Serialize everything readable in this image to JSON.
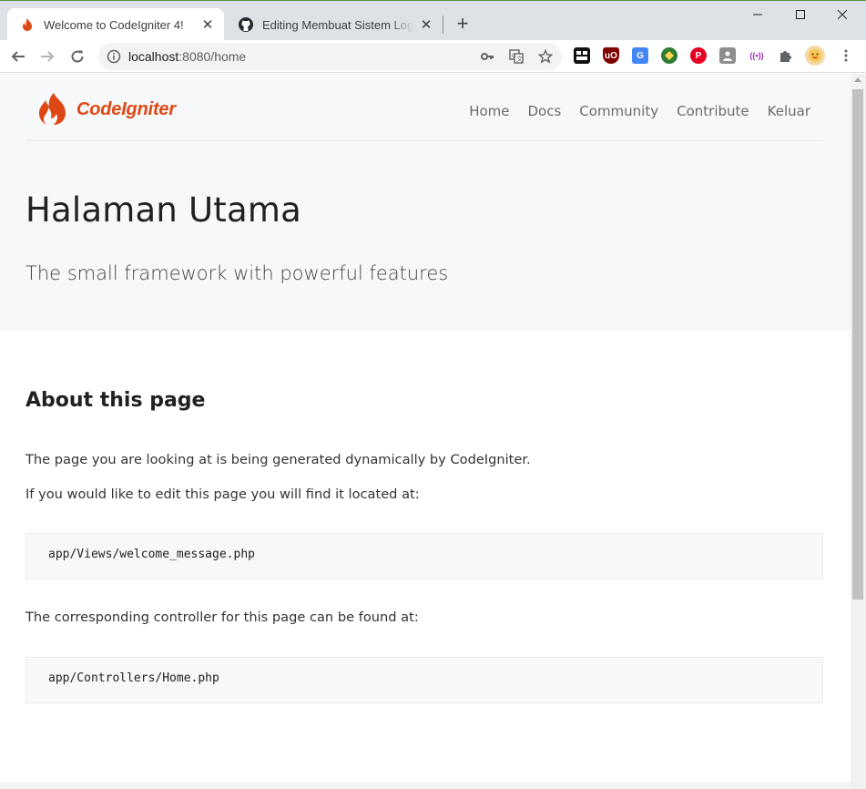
{
  "browser": {
    "tabs": [
      {
        "title": "Welcome to CodeIgniter 4!",
        "active": true,
        "icon": "codeigniter-flame-icon"
      },
      {
        "title": "Editing Membuat Sistem Login di",
        "active": false,
        "icon": "github-icon"
      }
    ],
    "url_host": "localhost",
    "url_path": ":8080/home",
    "extensions": [
      "tab-manager-icon",
      "ublock-icon",
      "google-translate-icon",
      "maps-extension-icon",
      "pinterest-icon",
      "profile-extension-icon",
      "broadcast-icon",
      "extensions-puzzle-icon",
      "profile-avatar-icon"
    ]
  },
  "page": {
    "brand": "CodeIgniter",
    "nav": [
      "Home",
      "Docs",
      "Community",
      "Contribute",
      "Keluar"
    ],
    "hero_title": "Halaman Utama",
    "hero_tagline": "The small framework with powerful features",
    "section_title": "About this page",
    "p1": "The page you are looking at is being generated dynamically by CodeIgniter.",
    "p2": "If you would like to edit this page you will find it located at:",
    "code1": "app/Views/welcome_message.php",
    "p3": "The corresponding controller for this page can be found at:",
    "code2": "app/Controllers/Home.php"
  },
  "colors": {
    "brand": "#dd4814",
    "hero_bg": "#f7f8f9",
    "tabbar_bg": "#dee1e6"
  }
}
